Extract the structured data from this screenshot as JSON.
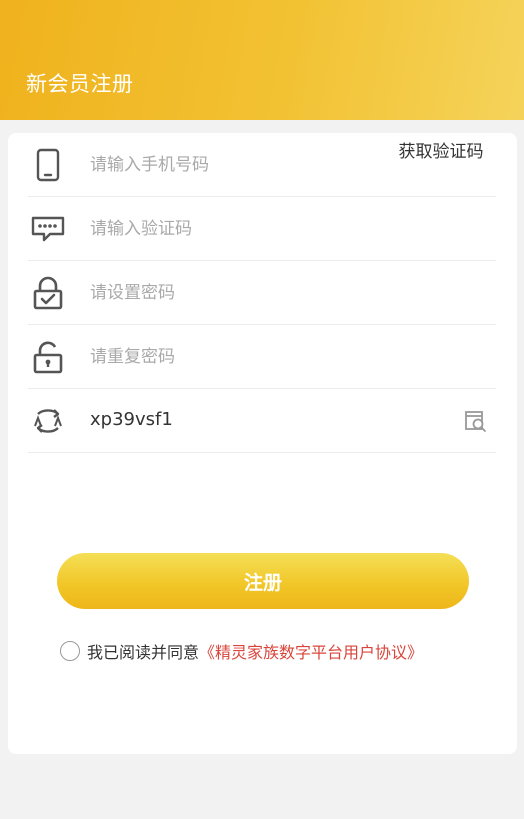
{
  "header": {
    "title": "新会员注册"
  },
  "form": {
    "phone": {
      "placeholder": "请输入手机号码",
      "icon": "mobile-phone-icon"
    },
    "get_code_label": "获取验证码",
    "sms_code": {
      "placeholder": "请输入验证码",
      "icon": "message-bubble-icon"
    },
    "password": {
      "placeholder": "请设置密码",
      "icon": "lock-check-icon"
    },
    "password_confirm": {
      "placeholder": "请重复密码",
      "icon": "lock-open-icon"
    },
    "captcha": {
      "value": "xp39vsf1",
      "icon": "swap-icon",
      "refresh_icon": "refresh-search-icon"
    }
  },
  "submit_label": "注册",
  "agreement": {
    "text": "我已阅读并同意",
    "link": "《精灵家族数字平台用户协议》"
  },
  "colors": {
    "accent": "#f1c526",
    "link": "#d9453b",
    "icon": "#555555"
  }
}
